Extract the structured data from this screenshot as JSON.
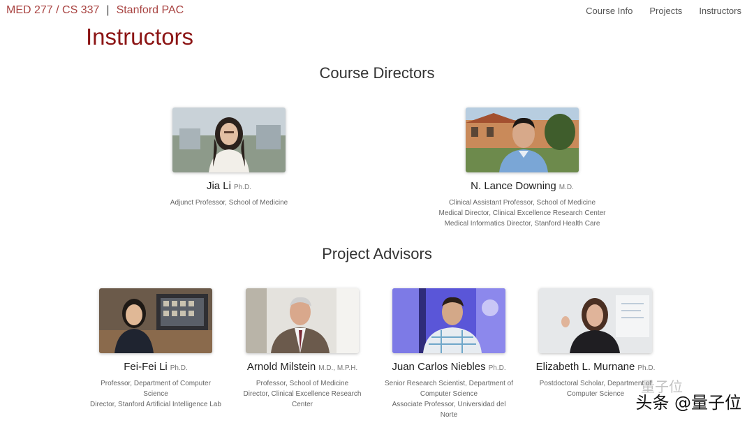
{
  "header": {
    "course": "MED 277 / CS 337",
    "separator": "|",
    "org": "Stanford PAC",
    "nav": [
      "Course Info",
      "Projects",
      "Instructors"
    ]
  },
  "page_title": "Instructors",
  "sections": {
    "directors": {
      "heading": "Course Directors",
      "people": [
        {
          "name": "Jia Li",
          "degree": "Ph.D.",
          "desc": [
            "Adjunct Professor, School of Medicine"
          ]
        },
        {
          "name": "N. Lance Downing",
          "degree": "M.D.",
          "desc": [
            "Clinical Assistant Professor, School of Medicine",
            "Medical Director, Clinical Excellence Research Center",
            "Medical Informatics Director, Stanford Health Care"
          ]
        }
      ]
    },
    "advisors": {
      "heading": "Project Advisors",
      "people": [
        {
          "name": "Fei-Fei Li",
          "degree": "Ph.D.",
          "desc": [
            "Professor, Department of Computer Science",
            "Director, Stanford Artificial Intelligence Lab"
          ]
        },
        {
          "name": "Arnold Milstein",
          "degree": "M.D., M.P.H.",
          "desc": [
            "Professor, School of Medicine",
            "Director, Clinical Excellence Research Center"
          ]
        },
        {
          "name": "Juan Carlos Niebles",
          "degree": "Ph.D.",
          "desc": [
            "Senior Research Scientist, Department of Computer Science",
            "Associate Professor, Universidad del Norte"
          ]
        },
        {
          "name": "Elizabeth L. Murnane",
          "degree": "Ph.D.",
          "desc": [
            "Postdoctoral Scholar, Department of Computer Science"
          ]
        }
      ]
    }
  },
  "watermark": {
    "text": "头条 @量子位",
    "faint": "量子位"
  }
}
